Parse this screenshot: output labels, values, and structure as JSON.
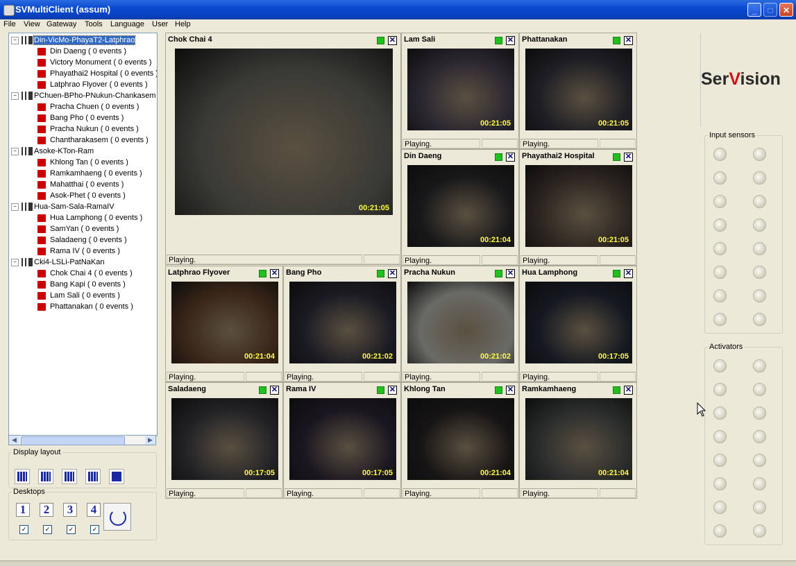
{
  "window": {
    "title": "SVMultiClient (assum)",
    "min": "_",
    "max": "□",
    "close": "✕"
  },
  "menu": [
    "File",
    "View",
    "Gateway",
    "Tools",
    "Language",
    "User",
    "Help"
  ],
  "tree": [
    {
      "type": "group",
      "label": "Din-VicMo-PhayaT2-Latphrao",
      "selected": true
    },
    {
      "type": "cam",
      "label": "Din Daeng ( 0 events )"
    },
    {
      "type": "cam",
      "label": "Victory Monument ( 0 events )"
    },
    {
      "type": "cam",
      "label": "Phayathai2 Hospital ( 0 events )"
    },
    {
      "type": "cam",
      "label": "Latphrao Flyover ( 0 events )"
    },
    {
      "type": "group",
      "label": "PChuen-BPho-PNukun-Chankasem"
    },
    {
      "type": "cam",
      "label": "Pracha Chuen ( 0 events )"
    },
    {
      "type": "cam",
      "label": "Bang Pho ( 0 events )"
    },
    {
      "type": "cam",
      "label": "Pracha Nukun ( 0 events )"
    },
    {
      "type": "cam",
      "label": "Chantharakasem ( 0 events )"
    },
    {
      "type": "group",
      "label": "Asoke-KTon-Ram"
    },
    {
      "type": "cam",
      "label": "Khlong Tan ( 0 events )"
    },
    {
      "type": "cam",
      "label": "Ramkamhaeng ( 0 events )"
    },
    {
      "type": "cam",
      "label": "Mahatthai ( 0 events )"
    },
    {
      "type": "cam",
      "label": "Asok-Phet ( 0 events )"
    },
    {
      "type": "group",
      "label": "Hua-Sam-Sala-RamaIV"
    },
    {
      "type": "cam",
      "label": "Hua Lamphong ( 0 events )"
    },
    {
      "type": "cam",
      "label": "SamYan ( 0 events )"
    },
    {
      "type": "cam",
      "label": "Saladaeng ( 0 events )"
    },
    {
      "type": "cam",
      "label": "Rama IV ( 0 events )"
    },
    {
      "type": "group",
      "label": "Cki4-LSLi-PatNaKan"
    },
    {
      "type": "cam",
      "label": "Chok Chai 4 ( 0 events )"
    },
    {
      "type": "cam",
      "label": "Bang Kapi ( 0 events )"
    },
    {
      "type": "cam",
      "label": "Lam Sali ( 0 events )"
    },
    {
      "type": "cam",
      "label": "Phattanakan ( 0 events )"
    }
  ],
  "display_layout": {
    "legend": "Display layout"
  },
  "desktops": {
    "legend": "Desktops",
    "buttons": [
      "1",
      "2",
      "3",
      "4"
    ],
    "checked": [
      true,
      true,
      true,
      true
    ]
  },
  "cameras": [
    {
      "name": "Chok Chai 4",
      "time": "00:21:05",
      "status": "Playing.",
      "tone": "#3a3a36"
    },
    {
      "name": "Lam Sali",
      "time": "00:21:05",
      "status": "Playing.",
      "tone": "#2a2630"
    },
    {
      "name": "Phattanakan",
      "time": "00:21:05",
      "status": "Playing.",
      "tone": "#1e1e24"
    },
    {
      "name": "Din Daeng",
      "time": "00:21:04",
      "status": "Playing.",
      "tone": "#18181a"
    },
    {
      "name": "Phayathai2 Hospital",
      "time": "00:21:05",
      "status": "Playing.",
      "tone": "#2c2420"
    },
    {
      "name": "Latphrao Flyover",
      "time": "00:21:04",
      "status": "Playing.",
      "tone": "#3a2618"
    },
    {
      "name": "Bang Pho",
      "time": "00:21:02",
      "status": "Playing.",
      "tone": "#1a1a22"
    },
    {
      "name": "Pracha Nukun",
      "time": "00:21:02",
      "status": "Playing.",
      "tone": "#6a6a66"
    },
    {
      "name": "Hua Lamphong",
      "time": "00:17:05",
      "status": "Playing.",
      "tone": "#141820"
    },
    {
      "name": "Saladaeng",
      "time": "00:17:05",
      "status": "Playing.",
      "tone": "#222226"
    },
    {
      "name": "Rama IV",
      "time": "00:17:05",
      "status": "Playing.",
      "tone": "#1a1620"
    },
    {
      "name": "Khlong Tan",
      "time": "00:21:04",
      "status": "Playing.",
      "tone": "#161414"
    },
    {
      "name": "Ramkamhaeng",
      "time": "00:21:04",
      "status": "Playing.",
      "tone": "#2a2c2c"
    }
  ],
  "logo": {
    "text_a": "Ser",
    "text_v": "V",
    "text_b": "ision",
    "accent": "#d0101a"
  },
  "input_sensors": {
    "legend": "Input sensors",
    "count": 16
  },
  "activators": {
    "legend": "Activators",
    "count": 16
  }
}
